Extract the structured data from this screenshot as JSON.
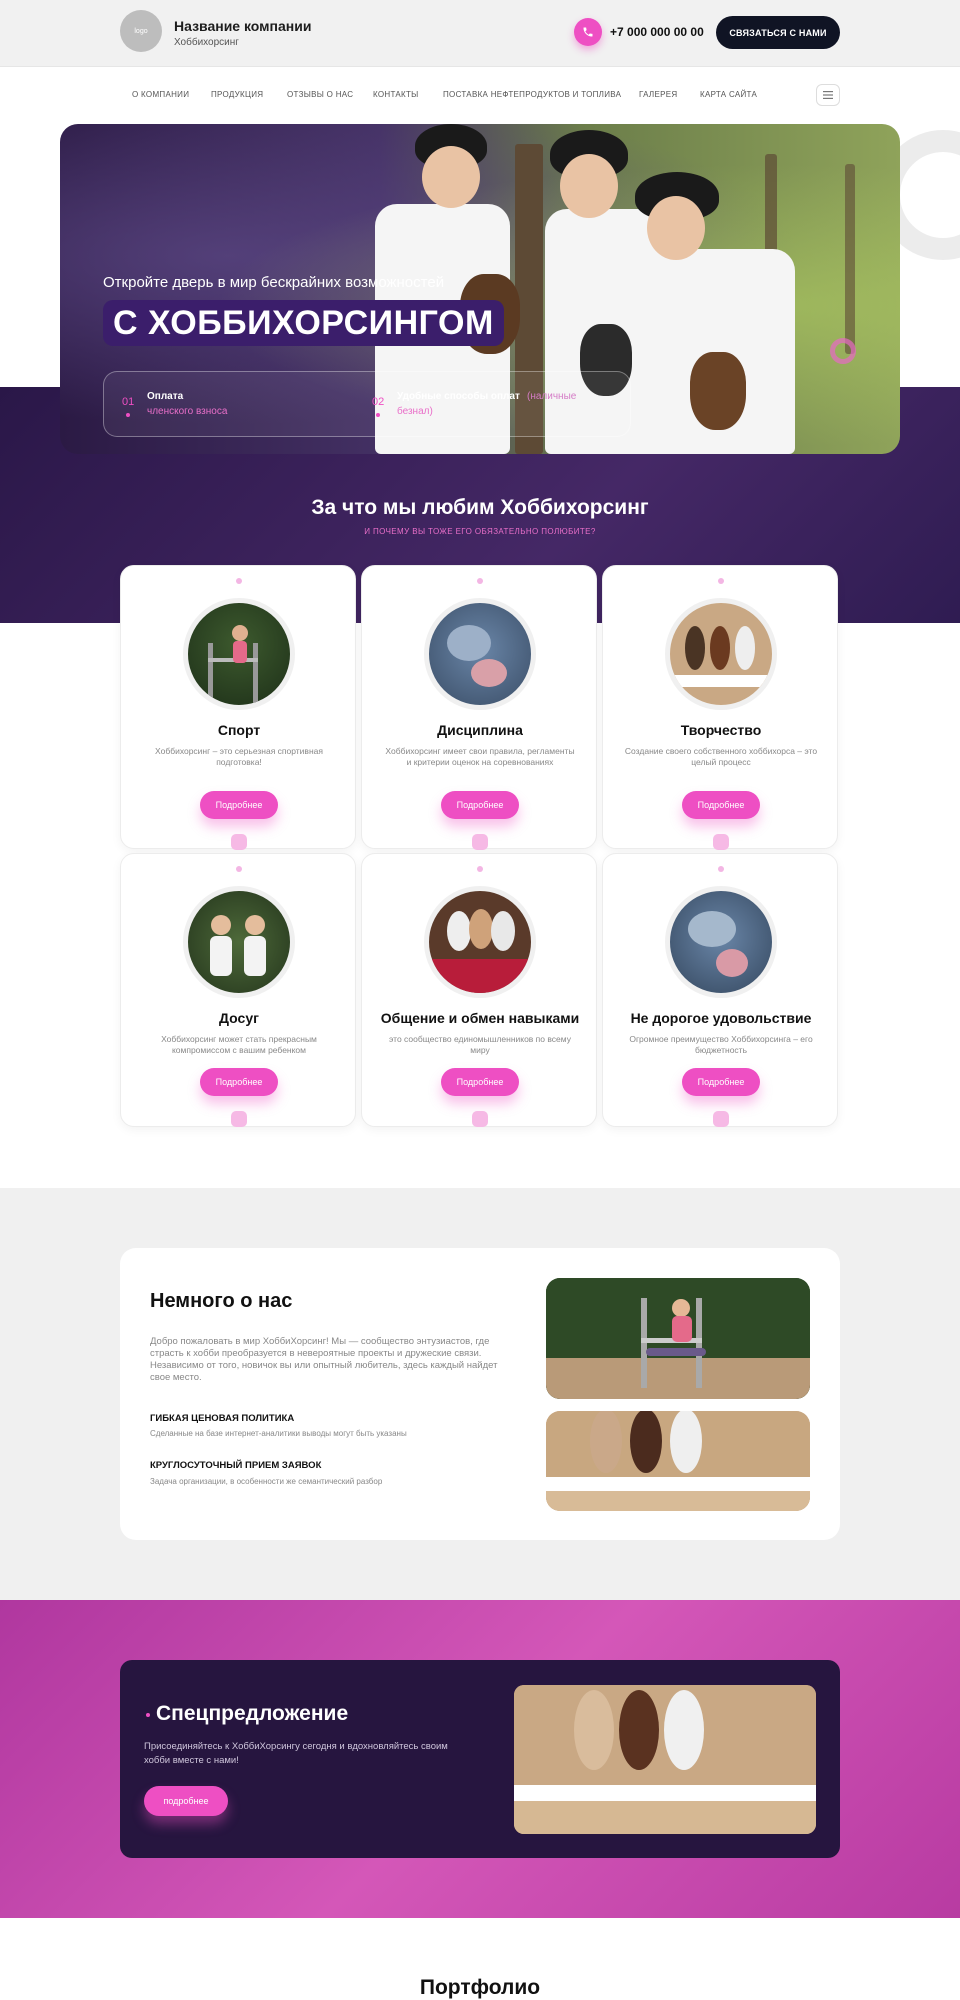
{
  "header": {
    "logo_text": "logo",
    "company_name": "Название компании",
    "company_sub": "Хоббихорсинг",
    "phone": "+7 000 000 00 00",
    "contact_button": "СВЯЗАТЬСЯ С НАМИ"
  },
  "nav": {
    "items": [
      "О КОМПАНИИ",
      "ПРОДУКЦИЯ",
      "ОТЗЫВЫ О НАС",
      "КОНТАКТЫ",
      "ПОСТАВКА НЕФТЕПРОДУКТОВ И ТОПЛИВА",
      "ГАЛЕРЕЯ",
      "КАРТА САЙТА"
    ]
  },
  "hero": {
    "subtitle": "Откройте дверь в мир бескрайних возможностей",
    "title": "С ХОББИХОРСИНГОМ",
    "info": [
      {
        "num": "01",
        "title": "Оплата",
        "sub": "членского взноса"
      },
      {
        "num": "02",
        "title": "Удобные способы оплат",
        "title_extra": "(наличные",
        "sub": "безнал)"
      }
    ]
  },
  "love": {
    "title": "За что мы любим Хоббихорсинг",
    "subtitle": "И ПОЧЕМУ ВЫ ТОЖЕ ЕГО ОБЯЗАТЕЛЬНО ПОЛЮБИТЕ?",
    "button_label": "Подробнее",
    "cards": [
      {
        "title": "Спорт",
        "desc": "Хоббихорсинг – это серьезная спортивная подготовка!"
      },
      {
        "title": "Дисциплина",
        "desc": "Хоббихорсинг имеет свои правила, регламенты и критерии оценок на соревнованиях"
      },
      {
        "title": "Творчество",
        "desc": "Создание своего собственного хоббихорса – это целый процесс"
      },
      {
        "title": "Досуг",
        "desc": "Хоббихорсинг может стать прекрасным компромиссом с вашим ребенком"
      },
      {
        "title": "Общение и обмен навыками",
        "desc": "это сообщество единомышленников по всему миру"
      },
      {
        "title": "Не дорогое удовольствие",
        "desc": "Огромное преимущество Хоббихорсинга – его бюджетность"
      }
    ]
  },
  "about": {
    "title": "Немного о нас",
    "text": "Добро пожаловать в мир ХоббиХорсинг! Мы — сообщество энтузиастов, где страсть к хобби преобразуется в невероятные проекты и дружеские связи. Независимо от того, новичок вы или опытный любитель, здесь каждый найдет свое место.",
    "features": [
      {
        "title": "ГИБКАЯ ЦЕНОВАЯ ПОЛИТИКА",
        "sub": "Сделанные на базе интернет-аналитики выводы могут быть указаны"
      },
      {
        "title": "КРУГЛОСУТОЧНЫЙ ПРИЕМ ЗАЯВОК",
        "sub": "Задача организации, в особенности же семантический разбор"
      }
    ]
  },
  "special": {
    "title": "Спецпредложение",
    "text": "Присоединяйтесь к ХоббиХорсингу сегодня и вдохновляйтесь своим хобби вместе с нами!",
    "button": "подробнее"
  },
  "portfolio": {
    "title": "Портфолио"
  },
  "colors": {
    "accent": "#ee4fc3",
    "dark_purple": "#26153f",
    "magenta": "#c745ad"
  },
  "icons": [
    "phone-icon",
    "menu-icon"
  ]
}
